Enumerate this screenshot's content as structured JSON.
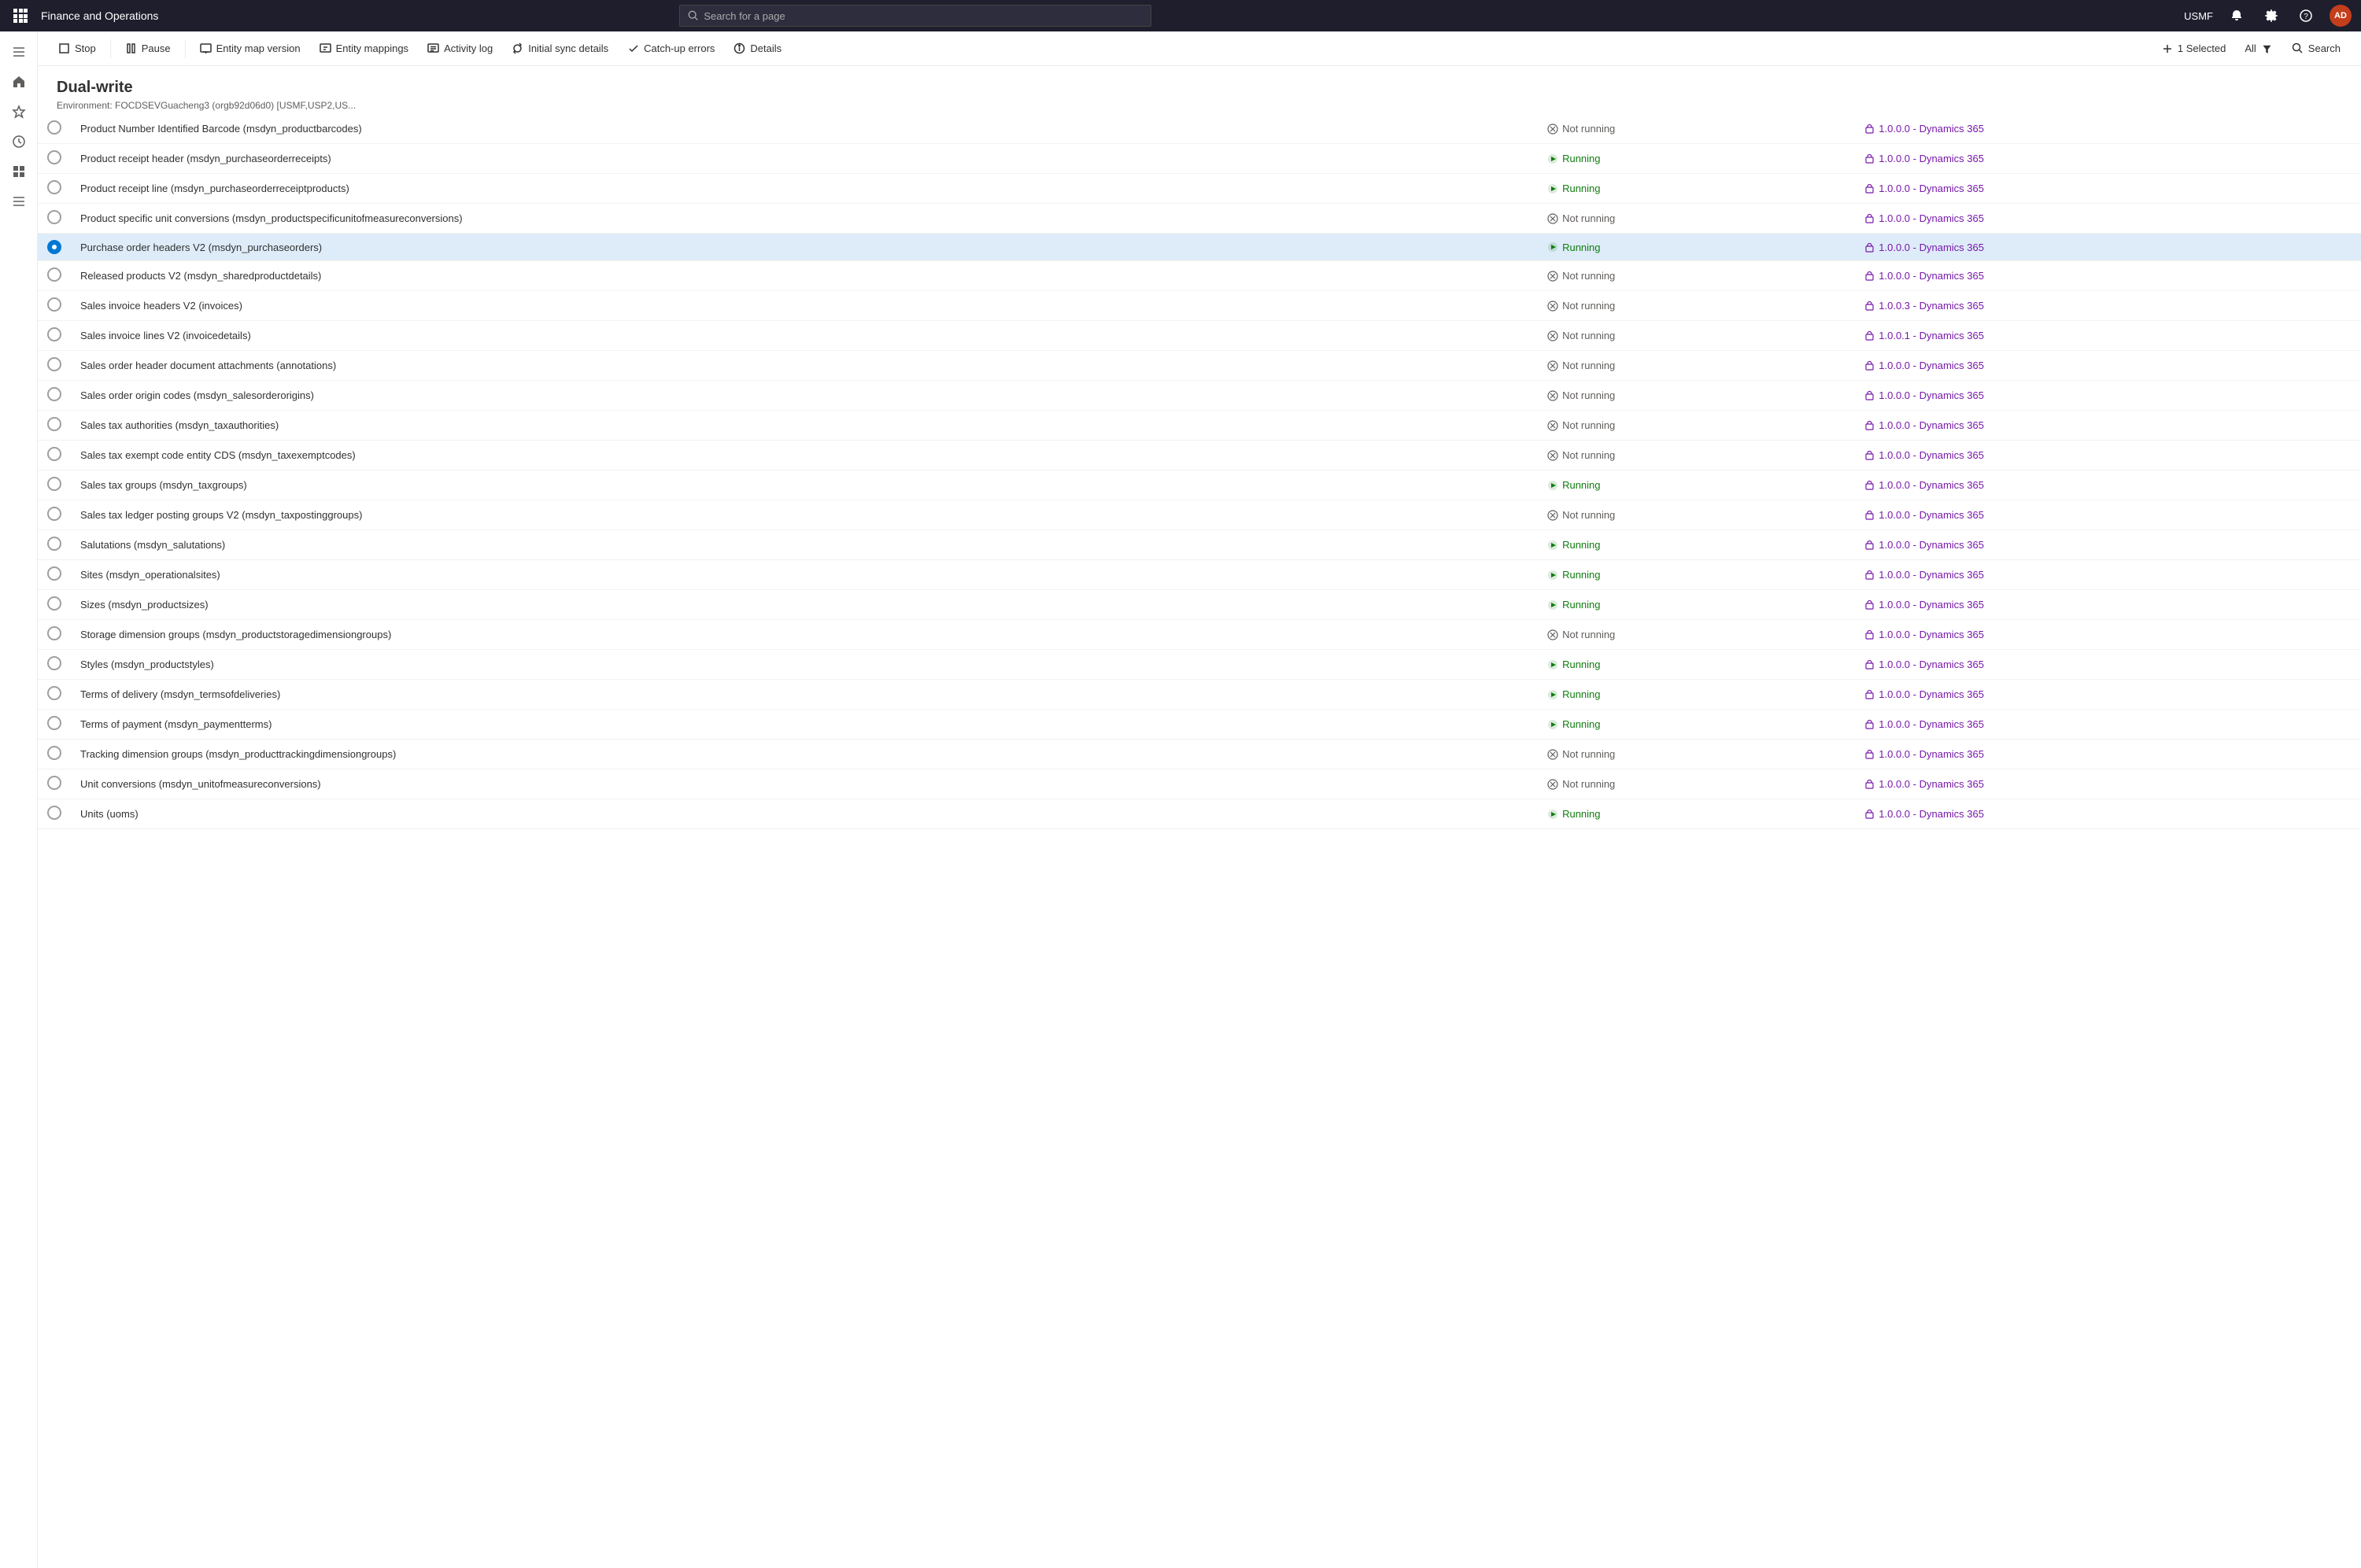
{
  "app": {
    "title": "Finance and Operations",
    "search_placeholder": "Search for a page",
    "user": "USMF",
    "avatar": "AD"
  },
  "command_bar": {
    "stop_label": "Stop",
    "pause_label": "Pause",
    "entity_map_version_label": "Entity map version",
    "entity_mappings_label": "Entity mappings",
    "activity_log_label": "Activity log",
    "initial_sync_label": "Initial sync details",
    "catchup_errors_label": "Catch-up errors",
    "details_label": "Details",
    "selected_label": "1 Selected",
    "filter_label": "All",
    "search_label": "Search"
  },
  "page": {
    "title": "Dual-write",
    "environment": "Environment:   FOCDSEVGuacheng3 (orgb92d06d0) [USMF,USP2,US..."
  },
  "table": {
    "rows": [
      {
        "name": "Product Number Identified Barcode (msdyn_productbarcodes)",
        "status": "Not running",
        "version": "1.0.0.0 - Dynamics 365",
        "selected": false
      },
      {
        "name": "Product receipt header (msdyn_purchaseorderreceipts)",
        "status": "Running",
        "version": "1.0.0.0 - Dynamics 365",
        "selected": false
      },
      {
        "name": "Product receipt line (msdyn_purchaseorderreceiptproducts)",
        "status": "Running",
        "version": "1.0.0.0 - Dynamics 365",
        "selected": false
      },
      {
        "name": "Product specific unit conversions (msdyn_productspecificunitofmeasureconversions)",
        "status": "Not running",
        "version": "1.0.0.0 - Dynamics 365",
        "selected": false
      },
      {
        "name": "Purchase order headers V2 (msdyn_purchaseorders)",
        "status": "Running",
        "version": "1.0.0.0 - Dynamics 365",
        "selected": true
      },
      {
        "name": "Released products V2 (msdyn_sharedproductdetails)",
        "status": "Not running",
        "version": "1.0.0.0 - Dynamics 365",
        "selected": false
      },
      {
        "name": "Sales invoice headers V2 (invoices)",
        "status": "Not running",
        "version": "1.0.0.3 - Dynamics 365",
        "selected": false
      },
      {
        "name": "Sales invoice lines V2 (invoicedetails)",
        "status": "Not running",
        "version": "1.0.0.1 - Dynamics 365",
        "selected": false
      },
      {
        "name": "Sales order header document attachments (annotations)",
        "status": "Not running",
        "version": "1.0.0.0 - Dynamics 365",
        "selected": false
      },
      {
        "name": "Sales order origin codes (msdyn_salesorderorigins)",
        "status": "Not running",
        "version": "1.0.0.0 - Dynamics 365",
        "selected": false
      },
      {
        "name": "Sales tax authorities (msdyn_taxauthorities)",
        "status": "Not running",
        "version": "1.0.0.0 - Dynamics 365",
        "selected": false
      },
      {
        "name": "Sales tax exempt code entity CDS (msdyn_taxexemptcodes)",
        "status": "Not running",
        "version": "1.0.0.0 - Dynamics 365",
        "selected": false
      },
      {
        "name": "Sales tax groups (msdyn_taxgroups)",
        "status": "Running",
        "version": "1.0.0.0 - Dynamics 365",
        "selected": false
      },
      {
        "name": "Sales tax ledger posting groups V2 (msdyn_taxpostinggroups)",
        "status": "Not running",
        "version": "1.0.0.0 - Dynamics 365",
        "selected": false
      },
      {
        "name": "Salutations (msdyn_salutations)",
        "status": "Running",
        "version": "1.0.0.0 - Dynamics 365",
        "selected": false
      },
      {
        "name": "Sites (msdyn_operationalsites)",
        "status": "Running",
        "version": "1.0.0.0 - Dynamics 365",
        "selected": false
      },
      {
        "name": "Sizes (msdyn_productsizes)",
        "status": "Running",
        "version": "1.0.0.0 - Dynamics 365",
        "selected": false
      },
      {
        "name": "Storage dimension groups (msdyn_productstoragedimensiongroups)",
        "status": "Not running",
        "version": "1.0.0.0 - Dynamics 365",
        "selected": false
      },
      {
        "name": "Styles (msdyn_productstyles)",
        "status": "Running",
        "version": "1.0.0.0 - Dynamics 365",
        "selected": false
      },
      {
        "name": "Terms of delivery (msdyn_termsofdeliveries)",
        "status": "Running",
        "version": "1.0.0.0 - Dynamics 365",
        "selected": false
      },
      {
        "name": "Terms of payment (msdyn_paymentterms)",
        "status": "Running",
        "version": "1.0.0.0 - Dynamics 365",
        "selected": false
      },
      {
        "name": "Tracking dimension groups (msdyn_producttrackingdimensiongroups)",
        "status": "Not running",
        "version": "1.0.0.0 - Dynamics 365",
        "selected": false
      },
      {
        "name": "Unit conversions (msdyn_unitofmeasureconversions)",
        "status": "Not running",
        "version": "1.0.0.0 - Dynamics 365",
        "selected": false
      },
      {
        "name": "Units (uoms)",
        "status": "Running",
        "version": "1.0.0.0 - Dynamics 365",
        "selected": false
      }
    ]
  }
}
